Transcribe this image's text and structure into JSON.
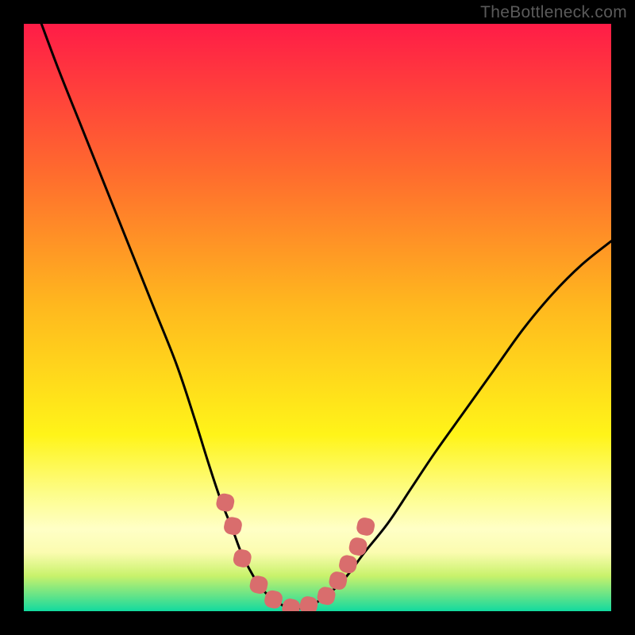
{
  "watermark": "TheBottleneck.com",
  "chart_data": {
    "type": "line",
    "title": "",
    "xlabel": "",
    "ylabel": "",
    "xlim": [
      0,
      100
    ],
    "ylim": [
      0,
      100
    ],
    "curve_left": {
      "name": "left-descending-curve",
      "x": [
        3,
        6,
        10,
        14,
        18,
        22,
        26,
        29,
        31.5,
        33.5,
        35.5,
        37,
        38.5,
        40,
        41.5,
        43,
        44.5,
        46
      ],
      "y": [
        100,
        92,
        82,
        72,
        62,
        52,
        42,
        33,
        25,
        19,
        14,
        10,
        7,
        4.5,
        2.8,
        1.6,
        0.8,
        0.3
      ]
    },
    "curve_right": {
      "name": "right-ascending-curve",
      "x": [
        46,
        48,
        50,
        52,
        55,
        58,
        62,
        66,
        70,
        75,
        80,
        85,
        90,
        95,
        100
      ],
      "y": [
        0.3,
        0.8,
        1.6,
        3,
        6,
        10,
        15,
        21,
        27,
        34,
        41,
        48,
        54,
        59,
        63
      ]
    },
    "markers": {
      "name": "marker-cluster",
      "color": "#d96d6d",
      "points": [
        {
          "x": 34.3,
          "y": 18.5
        },
        {
          "x": 35.6,
          "y": 14.5
        },
        {
          "x": 37.2,
          "y": 9.0
        },
        {
          "x": 40.0,
          "y": 4.5
        },
        {
          "x": 42.5,
          "y": 2.0
        },
        {
          "x": 45.5,
          "y": 0.6
        },
        {
          "x": 48.5,
          "y": 1.0
        },
        {
          "x": 51.5,
          "y": 2.6
        },
        {
          "x": 53.5,
          "y": 5.2
        },
        {
          "x": 55.2,
          "y": 8.0
        },
        {
          "x": 56.9,
          "y": 11.0
        },
        {
          "x": 58.2,
          "y": 14.4
        }
      ]
    },
    "gradient_stops": [
      {
        "offset": 0,
        "color": "#ff1c47"
      },
      {
        "offset": 0.25,
        "color": "#ff6a2e"
      },
      {
        "offset": 0.48,
        "color": "#ffb81e"
      },
      {
        "offset": 0.7,
        "color": "#fff419"
      },
      {
        "offset": 0.8,
        "color": "#fdfd8a"
      },
      {
        "offset": 0.86,
        "color": "#ffffc6"
      },
      {
        "offset": 0.9,
        "color": "#fbfcb0"
      },
      {
        "offset": 0.94,
        "color": "#c8f26b"
      },
      {
        "offset": 0.97,
        "color": "#6fe585"
      },
      {
        "offset": 1.0,
        "color": "#12da9f"
      }
    ]
  }
}
